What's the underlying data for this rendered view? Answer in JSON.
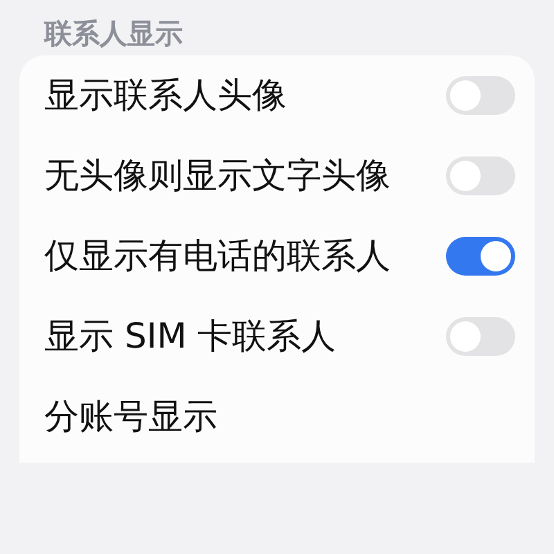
{
  "section_title": "联系人显示",
  "settings": [
    {
      "label": "显示联系人头像",
      "on": false
    },
    {
      "label": "无头像则显示文字头像",
      "on": false
    },
    {
      "label": "仅显示有电话的联系人",
      "on": true
    },
    {
      "label": "显示 SIM 卡联系人",
      "on": false
    },
    {
      "label": "分账号显示"
    }
  ]
}
